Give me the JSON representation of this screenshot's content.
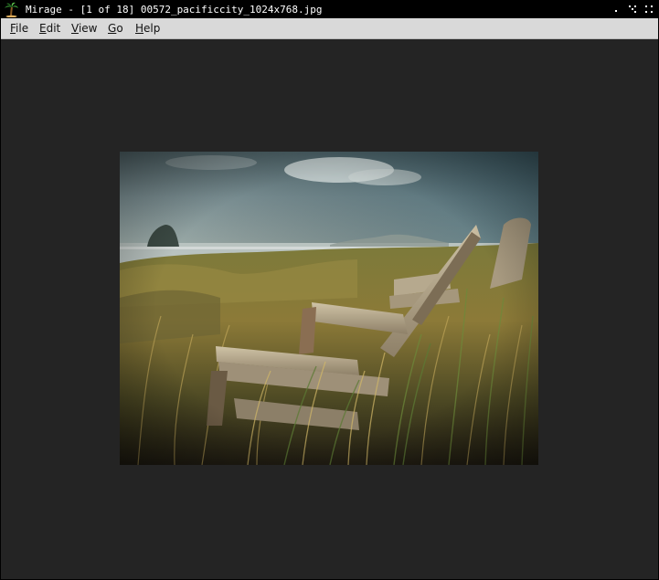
{
  "window": {
    "title": "Mirage - [1 of 18] 00572_pacificcity_1024x768.jpg",
    "app_icon": "palm-tree-icon"
  },
  "window_controls": [
    {
      "name": "minimize-button",
      "icon": "minimize-dot-icon"
    },
    {
      "name": "maximize-button",
      "icon": "maximize-dots-icon"
    },
    {
      "name": "close-button",
      "icon": "close-dots-icon"
    }
  ],
  "menubar": {
    "items": [
      {
        "label_mnemonic": "F",
        "label_rest": "ile"
      },
      {
        "label_mnemonic": "E",
        "label_rest": "dit"
      },
      {
        "label_mnemonic": "V",
        "label_rest": "iew"
      },
      {
        "label_mnemonic": "G",
        "label_rest": "o"
      },
      {
        "label_mnemonic": "H",
        "label_rest": "elp"
      }
    ]
  },
  "viewer": {
    "background_color": "#242424"
  }
}
